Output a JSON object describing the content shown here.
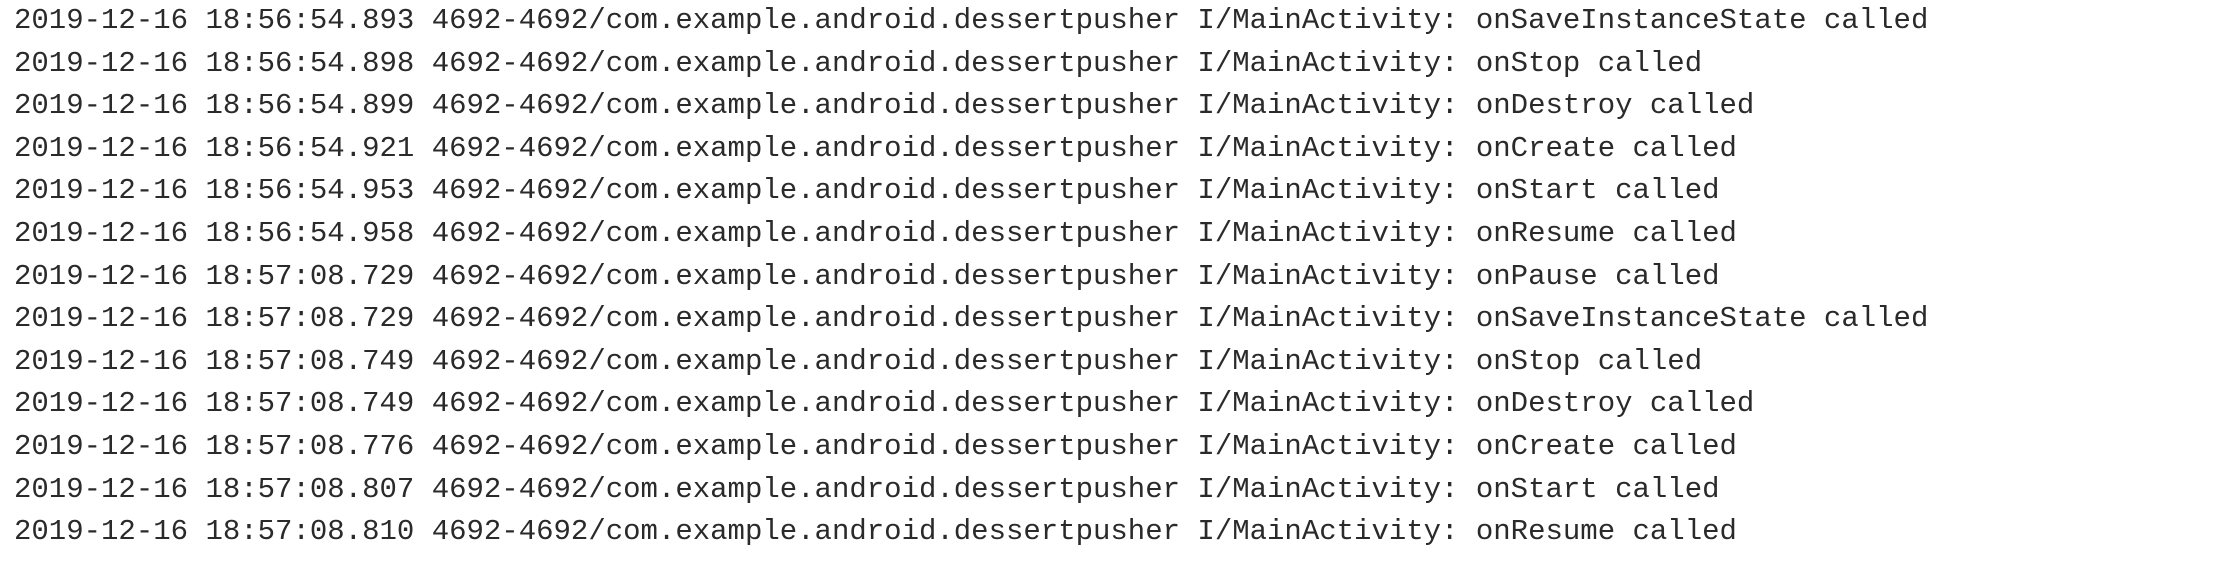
{
  "log": {
    "lines": [
      {
        "date": "2019-12-16",
        "time": "18:56:54.893",
        "pid": "4692-4692/com.example.android.dessertpusher",
        "tag": "I/MainActivity:",
        "message": "onSaveInstanceState called"
      },
      {
        "date": "2019-12-16",
        "time": "18:56:54.898",
        "pid": "4692-4692/com.example.android.dessertpusher",
        "tag": "I/MainActivity:",
        "message": "onStop called"
      },
      {
        "date": "2019-12-16",
        "time": "18:56:54.899",
        "pid": "4692-4692/com.example.android.dessertpusher",
        "tag": "I/MainActivity:",
        "message": "onDestroy called"
      },
      {
        "date": "2019-12-16",
        "time": "18:56:54.921",
        "pid": "4692-4692/com.example.android.dessertpusher",
        "tag": "I/MainActivity:",
        "message": "onCreate called"
      },
      {
        "date": "2019-12-16",
        "time": "18:56:54.953",
        "pid": "4692-4692/com.example.android.dessertpusher",
        "tag": "I/MainActivity:",
        "message": "onStart called"
      },
      {
        "date": "2019-12-16",
        "time": "18:56:54.958",
        "pid": "4692-4692/com.example.android.dessertpusher",
        "tag": "I/MainActivity:",
        "message": "onResume called"
      },
      {
        "date": "2019-12-16",
        "time": "18:57:08.729",
        "pid": "4692-4692/com.example.android.dessertpusher",
        "tag": "I/MainActivity:",
        "message": "onPause called"
      },
      {
        "date": "2019-12-16",
        "time": "18:57:08.729",
        "pid": "4692-4692/com.example.android.dessertpusher",
        "tag": "I/MainActivity:",
        "message": "onSaveInstanceState called"
      },
      {
        "date": "2019-12-16",
        "time": "18:57:08.749",
        "pid": "4692-4692/com.example.android.dessertpusher",
        "tag": "I/MainActivity:",
        "message": "onStop called"
      },
      {
        "date": "2019-12-16",
        "time": "18:57:08.749",
        "pid": "4692-4692/com.example.android.dessertpusher",
        "tag": "I/MainActivity:",
        "message": "onDestroy called"
      },
      {
        "date": "2019-12-16",
        "time": "18:57:08.776",
        "pid": "4692-4692/com.example.android.dessertpusher",
        "tag": "I/MainActivity:",
        "message": "onCreate called"
      },
      {
        "date": "2019-12-16",
        "time": "18:57:08.807",
        "pid": "4692-4692/com.example.android.dessertpusher",
        "tag": "I/MainActivity:",
        "message": "onStart called"
      },
      {
        "date": "2019-12-16",
        "time": "18:57:08.810",
        "pid": "4692-4692/com.example.android.dessertpusher",
        "tag": "I/MainActivity:",
        "message": "onResume called"
      }
    ]
  }
}
